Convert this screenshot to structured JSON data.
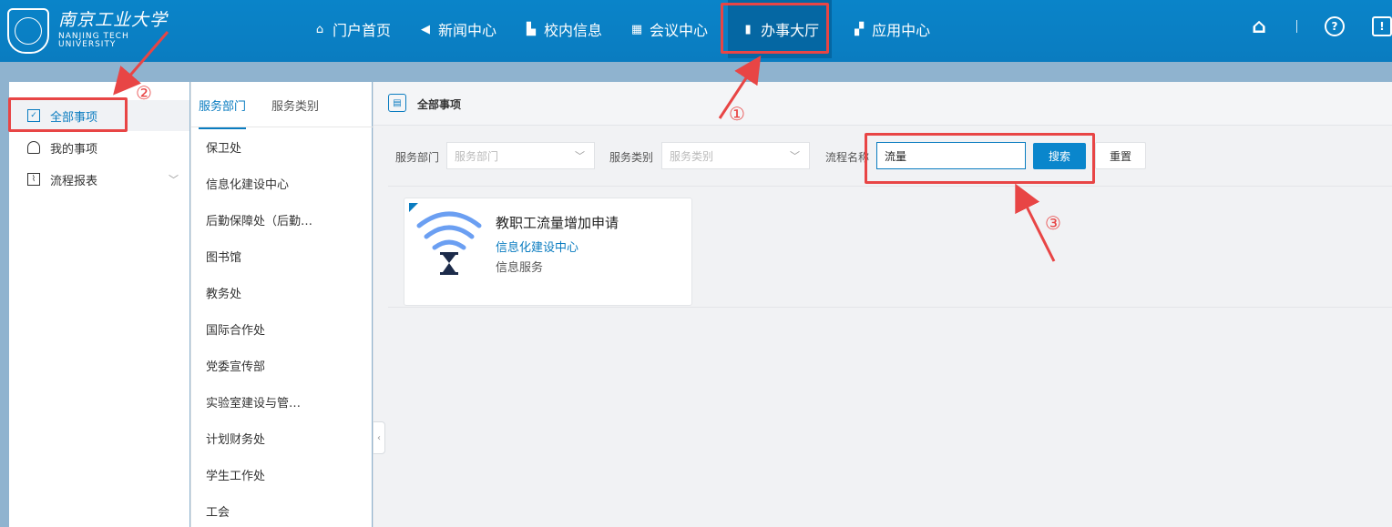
{
  "header": {
    "logo": {
      "cn": "南京工业大学",
      "en_line1": "NANJING TECH",
      "en_line2": "UNIVERSITY"
    },
    "nav": [
      {
        "label": "门户首页",
        "icon": "home-icon"
      },
      {
        "label": "新闻中心",
        "icon": "speaker-icon"
      },
      {
        "label": "校内信息",
        "icon": "building-icon"
      },
      {
        "label": "会议中心",
        "icon": "table-icon"
      },
      {
        "label": "办事大厅",
        "icon": "lock-icon",
        "active": true
      },
      {
        "label": "应用中心",
        "icon": "grid-icon"
      }
    ],
    "right_icons": {
      "home": "⌂",
      "help": "?",
      "feedback": "!"
    }
  },
  "sidebar": {
    "items": [
      {
        "label": "全部事项",
        "icon": "checkbox-icon",
        "active": true
      },
      {
        "label": "我的事项",
        "icon": "user-icon"
      },
      {
        "label": "流程报表",
        "icon": "chart-icon",
        "has_arrow": true
      }
    ]
  },
  "dept_panel": {
    "tabs": [
      {
        "label": "服务部门",
        "active": true
      },
      {
        "label": "服务类别"
      }
    ],
    "departments": [
      "保卫处",
      "信息化建设中心",
      "后勤保障处（后勤…",
      "图书馆",
      "教务处",
      "国际合作处",
      "党委宣传部",
      "实验室建设与管…",
      "计划财务处",
      "学生工作处",
      "工会"
    ]
  },
  "main": {
    "breadcrumb": "全部事项",
    "filters": {
      "dept_label": "服务部门",
      "dept_placeholder": "服务部门",
      "category_label": "服务类别",
      "category_placeholder": "服务类别",
      "name_label": "流程名称",
      "name_value": "流量",
      "search_button": "搜索",
      "reset_button": "重置"
    },
    "results": [
      {
        "title": "教职工流量增加申请",
        "department": "信息化建设中心",
        "category": "信息服务"
      }
    ]
  },
  "annotations": {
    "step1": "①",
    "step2": "②",
    "step3": "③"
  },
  "colors": {
    "primary": "#0a7cc0",
    "header": "#0a84c9",
    "annotation": "#e84545"
  }
}
